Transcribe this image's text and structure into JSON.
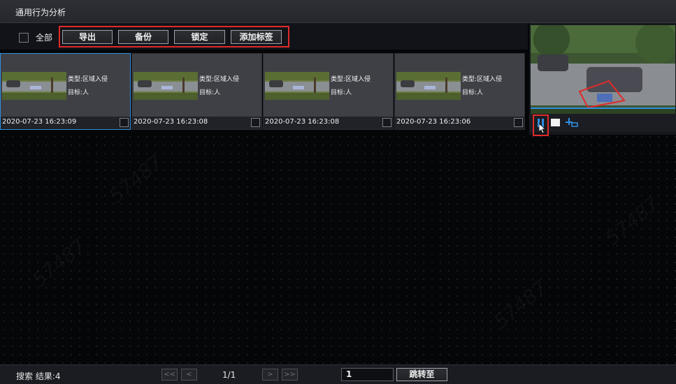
{
  "window": {
    "title": "通用行为分析"
  },
  "toolbar": {
    "select_all_label": "全部",
    "export_label": "导出",
    "backup_label": "备份",
    "lock_label": "锁定",
    "add_tag_label": "添加标签"
  },
  "results": [
    {
      "type": "类型:区域入侵",
      "target": "目标:人",
      "timestamp": "2020-07-23 16:23:09",
      "selected": true
    },
    {
      "type": "类型:区域入侵",
      "target": "目标:人",
      "timestamp": "2020-07-23 16:23:08",
      "selected": false
    },
    {
      "type": "类型:区域入侵",
      "target": "目标:人",
      "timestamp": "2020-07-23 16:23:08",
      "selected": false
    },
    {
      "type": "类型:区域入侵",
      "target": "目标:人",
      "timestamp": "2020-07-23 16:23:06",
      "selected": false
    }
  ],
  "preview": {
    "icons": [
      "pause-icon",
      "stop-icon",
      "snapshot-icon"
    ],
    "accent": "#2f8fe0",
    "highlight": "#e02a2a"
  },
  "status": {
    "result_label": "搜索 结果:4",
    "first_label": "<<",
    "prev_label": "<",
    "page_info": "1/1",
    "next_label": ">",
    "last_label": ">>",
    "page_input": "1",
    "go_label": "跳转至"
  },
  "watermark": "57487"
}
